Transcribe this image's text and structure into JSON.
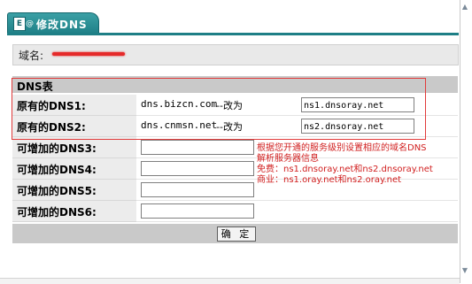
{
  "tab": {
    "at_symbol": "@",
    "title": "修改DNS"
  },
  "domain": {
    "label": "域名:"
  },
  "dns_table": {
    "header": "DNS表",
    "rows": [
      {
        "label": "原有的DNS1:",
        "old_value": "dns.bizcn.com",
        "change_to": "--改为",
        "new_value": "ns1.dnsoray.net"
      },
      {
        "label": "原有的DNS2:",
        "old_value": "dns.cnmsn.net",
        "change_to": "--改为",
        "new_value": "ns2.dnsoray.net"
      },
      {
        "label": "可增加的DNS3:",
        "new_value": ""
      },
      {
        "label": "可增加的DNS4:",
        "new_value": ""
      },
      {
        "label": "可增加的DNS5:",
        "new_value": ""
      },
      {
        "label": "可增加的DNS6:",
        "new_value": ""
      }
    ]
  },
  "note": {
    "line1": "根据您开通的服务级别设置相应的域名DNS",
    "line2": "解析服务器信息",
    "line3": "免费：ns1.dnsoray.net和ns2.dnsoray.net",
    "line4": "商业：ns1.oray.net和ns2.oray.net"
  },
  "submit": {
    "label": "确 定"
  },
  "colors": {
    "tab": "#1e7f86",
    "annotation": "#e23b3b",
    "note_text": "#d12020",
    "redaction": "#e52a2a"
  }
}
